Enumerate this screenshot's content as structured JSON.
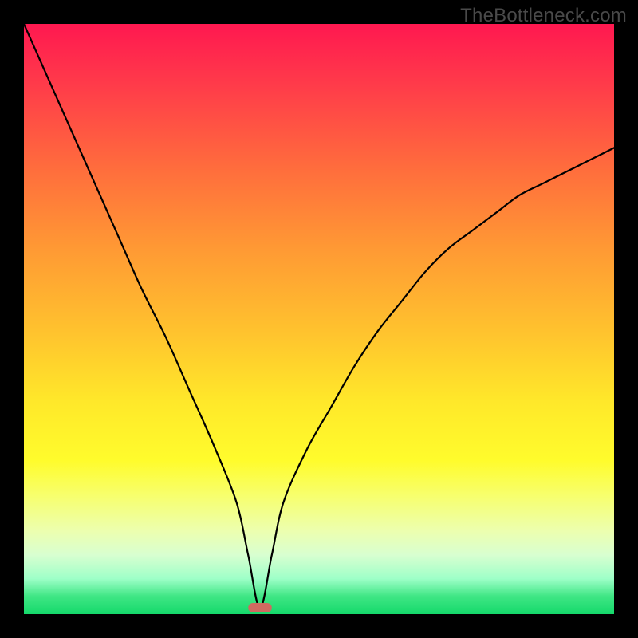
{
  "watermark": "TheBottleneck.com",
  "colors": {
    "frame_bg": "#000000",
    "gradient_top": "#ff1850",
    "gradient_bottom": "#15d96b",
    "curve": "#000000",
    "marker": "#cf6a60"
  },
  "chart_data": {
    "type": "line",
    "title": "",
    "xlabel": "",
    "ylabel": "",
    "xlim": [
      0,
      100
    ],
    "ylim": [
      0,
      100
    ],
    "grid": false,
    "legend": false,
    "background": "rainbow-vertical-gradient",
    "min_marker": {
      "x": 40,
      "width": 4,
      "y": 1
    },
    "x": [
      0,
      4,
      8,
      12,
      16,
      20,
      24,
      28,
      32,
      36,
      38,
      40,
      42,
      44,
      48,
      52,
      56,
      60,
      64,
      68,
      72,
      76,
      80,
      84,
      88,
      92,
      96,
      100
    ],
    "values": [
      100,
      91,
      82,
      73,
      64,
      55,
      47,
      38,
      29,
      19,
      10,
      1,
      10,
      19,
      28,
      35,
      42,
      48,
      53,
      58,
      62,
      65,
      68,
      71,
      73,
      75,
      77,
      79
    ],
    "series": [
      {
        "name": "bottleneck-curve",
        "values_ref": "values"
      }
    ],
    "notes": "Values read from the plotted curve against a 0–100 viewport in each axis; minimum at x≈40."
  }
}
